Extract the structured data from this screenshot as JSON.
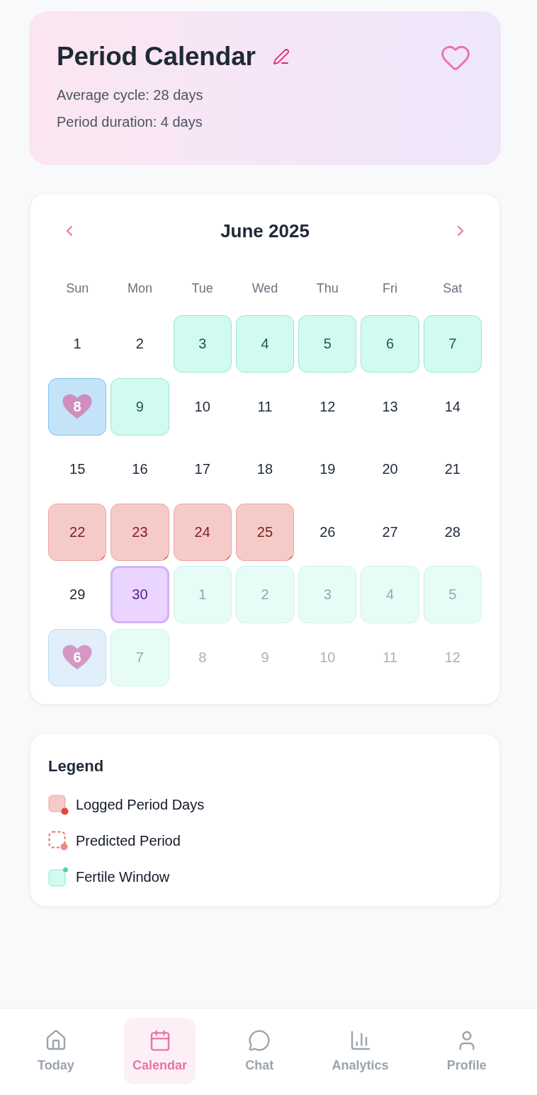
{
  "header": {
    "title": "Period Calendar",
    "stats": [
      "Average cycle: 28 days",
      "Period duration: 4 days"
    ]
  },
  "calendar": {
    "month": "June 2025",
    "weekdays": [
      "Sun",
      "Mon",
      "Tue",
      "Wed",
      "Thu",
      "Fri",
      "Sat"
    ],
    "weeks": [
      {
        "days": [
          {
            "day": "1",
            "kind": "plain",
            "outside": false
          },
          {
            "day": "2",
            "kind": "plain",
            "outside": false
          },
          {
            "day": "3",
            "kind": "fertile",
            "outside": false
          },
          {
            "day": "4",
            "kind": "fertile",
            "outside": false
          },
          {
            "day": "5",
            "kind": "fertile",
            "outside": false
          },
          {
            "day": "6",
            "kind": "fertile",
            "outside": false
          },
          {
            "day": "7",
            "kind": "fertile",
            "outside": false
          }
        ]
      },
      {
        "days": [
          {
            "day": "8",
            "kind": "ovulation",
            "outside": false
          },
          {
            "day": "9",
            "kind": "fertile",
            "outside": false
          },
          {
            "day": "10",
            "kind": "plain",
            "outside": false
          },
          {
            "day": "11",
            "kind": "plain",
            "outside": false
          },
          {
            "day": "12",
            "kind": "plain",
            "outside": false
          },
          {
            "day": "13",
            "kind": "plain",
            "outside": false
          },
          {
            "day": "14",
            "kind": "plain",
            "outside": false
          }
        ]
      },
      {
        "days": [
          {
            "day": "15",
            "kind": "plain",
            "outside": false
          },
          {
            "day": "16",
            "kind": "plain",
            "outside": false
          },
          {
            "day": "17",
            "kind": "plain",
            "outside": false
          },
          {
            "day": "18",
            "kind": "plain",
            "outside": false
          },
          {
            "day": "19",
            "kind": "plain",
            "outside": false
          },
          {
            "day": "20",
            "kind": "plain",
            "outside": false
          },
          {
            "day": "21",
            "kind": "plain",
            "outside": false
          }
        ]
      },
      {
        "days": [
          {
            "day": "22",
            "kind": "period",
            "outside": false
          },
          {
            "day": "23",
            "kind": "period",
            "outside": false
          },
          {
            "day": "24",
            "kind": "period",
            "outside": false
          },
          {
            "day": "25",
            "kind": "period",
            "outside": false
          },
          {
            "day": "26",
            "kind": "plain",
            "outside": false
          },
          {
            "day": "27",
            "kind": "plain",
            "outside": false
          },
          {
            "day": "28",
            "kind": "plain",
            "outside": false
          }
        ]
      },
      {
        "days": [
          {
            "day": "29",
            "kind": "plain",
            "outside": false
          },
          {
            "day": "30",
            "kind": "today",
            "outside": false
          },
          {
            "day": "1",
            "kind": "fertile",
            "outside": true
          },
          {
            "day": "2",
            "kind": "fertile",
            "outside": true
          },
          {
            "day": "3",
            "kind": "fertile",
            "outside": true
          },
          {
            "day": "4",
            "kind": "fertile",
            "outside": true
          },
          {
            "day": "5",
            "kind": "fertile",
            "outside": true
          }
        ]
      },
      {
        "days": [
          {
            "day": "6",
            "kind": "ovulation",
            "outside": true
          },
          {
            "day": "7",
            "kind": "fertile",
            "outside": true
          },
          {
            "day": "8",
            "kind": "plain",
            "outside": true
          },
          {
            "day": "9",
            "kind": "plain",
            "outside": true
          },
          {
            "day": "10",
            "kind": "plain",
            "outside": true
          },
          {
            "day": "11",
            "kind": "plain",
            "outside": true
          },
          {
            "day": "12",
            "kind": "plain",
            "outside": true
          }
        ]
      }
    ]
  },
  "legend": {
    "title": "Legend",
    "items": [
      {
        "label": "Logged Period Days",
        "kind": "logged"
      },
      {
        "label": "Predicted Period",
        "kind": "predicted"
      },
      {
        "label": "Fertile Window",
        "kind": "fertile"
      }
    ]
  },
  "nav": [
    {
      "label": "Today",
      "selected": false
    },
    {
      "label": "Calendar",
      "selected": true
    },
    {
      "label": "Chat",
      "selected": false
    },
    {
      "label": "Analytics",
      "selected": false
    },
    {
      "label": "Profile",
      "selected": false
    }
  ]
}
